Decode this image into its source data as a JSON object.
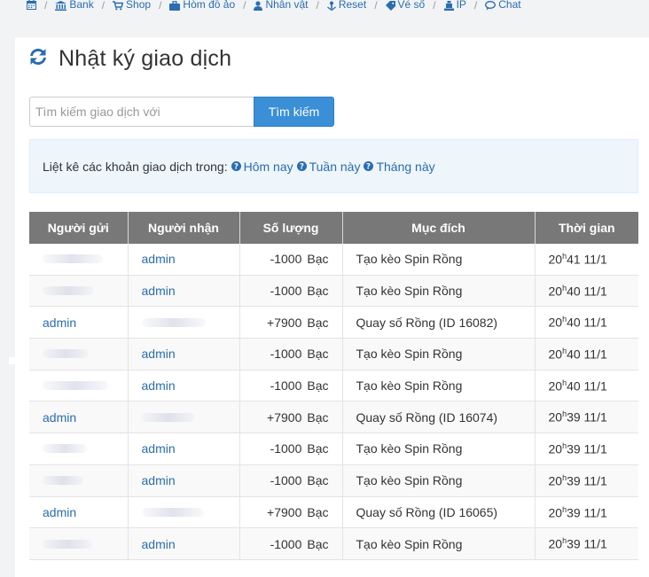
{
  "nav": {
    "items": [
      {
        "label": "",
        "icon": "calendar-icon"
      },
      {
        "label": "Bank",
        "icon": "bank-icon"
      },
      {
        "label": "Shop",
        "icon": "cart-icon"
      },
      {
        "label": "Hòm đồ ảo",
        "icon": "briefcase-icon"
      },
      {
        "label": "Nhân vật",
        "icon": "user-icon"
      },
      {
        "label": "Reset",
        "icon": "reset-icon"
      },
      {
        "label": "Vé số",
        "icon": "ticket-icon"
      },
      {
        "label": "IP",
        "icon": "ip-icon"
      },
      {
        "label": "Chat",
        "icon": "chat-icon"
      }
    ]
  },
  "page": {
    "title": "Nhật ký giao dịch",
    "title_icon": "refresh-icon"
  },
  "search": {
    "placeholder": "Tìm kiếm giao dịch với",
    "value": "",
    "button_label": "Tìm kiếm"
  },
  "filter": {
    "label": "Liệt kê các khoản giao dịch trong:",
    "today": "Hôm nay",
    "week": "Tuần này",
    "month": "Tháng này"
  },
  "table": {
    "headers": [
      "Người gửi",
      "Người nhận",
      "Số lượng",
      "Mục đích",
      "Thời gian"
    ],
    "rows": [
      {
        "sender": "",
        "receiver": "admin",
        "amount": "-1000",
        "unit": "Bạc",
        "purpose": "Tạo kèo Spin Rồng",
        "hour": "20",
        "sup": "h",
        "rest": "41 11/1"
      },
      {
        "sender": "",
        "receiver": "admin",
        "amount": "-1000",
        "unit": "Bạc",
        "purpose": "Tạo kèo Spin Rồng",
        "hour": "20",
        "sup": "h",
        "rest": "40 11/1"
      },
      {
        "sender": "admin",
        "receiver": "",
        "amount": "+7900",
        "unit": "Bạc",
        "purpose": "Quay số Rồng (ID 16082)",
        "hour": "20",
        "sup": "h",
        "rest": "40 11/1"
      },
      {
        "sender": "",
        "receiver": "admin",
        "amount": "-1000",
        "unit": "Bạc",
        "purpose": "Tạo kèo Spin Rồng",
        "hour": "20",
        "sup": "h",
        "rest": "40 11/1"
      },
      {
        "sender": "",
        "receiver": "admin",
        "amount": "-1000",
        "unit": "Bạc",
        "purpose": "Tạo kèo Spin Rồng",
        "hour": "20",
        "sup": "h",
        "rest": "40 11/1"
      },
      {
        "sender": "admin",
        "receiver": "",
        "amount": "+7900",
        "unit": "Bạc",
        "purpose": "Quay số Rồng (ID 16074)",
        "hour": "20",
        "sup": "h",
        "rest": "39 11/1"
      },
      {
        "sender": "",
        "receiver": "admin",
        "amount": "-1000",
        "unit": "Bạc",
        "purpose": "Tạo kèo Spin Rồng",
        "hour": "20",
        "sup": "h",
        "rest": "39 11/1"
      },
      {
        "sender": "",
        "receiver": "admin",
        "amount": "-1000",
        "unit": "Bạc",
        "purpose": "Tạo kèo Spin Rồng",
        "hour": "20",
        "sup": "h",
        "rest": "39 11/1"
      },
      {
        "sender": "admin",
        "receiver": "",
        "amount": "+7900",
        "unit": "Bạc",
        "purpose": "Quay số Rồng (ID 16065)",
        "hour": "20",
        "sup": "h",
        "rest": "39 11/1"
      },
      {
        "sender": "",
        "receiver": "admin",
        "amount": "-1000",
        "unit": "Bạc",
        "purpose": "Tạo kèo Spin Rồng",
        "hour": "20",
        "sup": "h",
        "rest": "39 11/1"
      }
    ]
  },
  "colors": {
    "link": "#2a6db0",
    "button": "#3a8fd6",
    "header_bg": "#787878",
    "filter_bg": "#eef5fb"
  }
}
